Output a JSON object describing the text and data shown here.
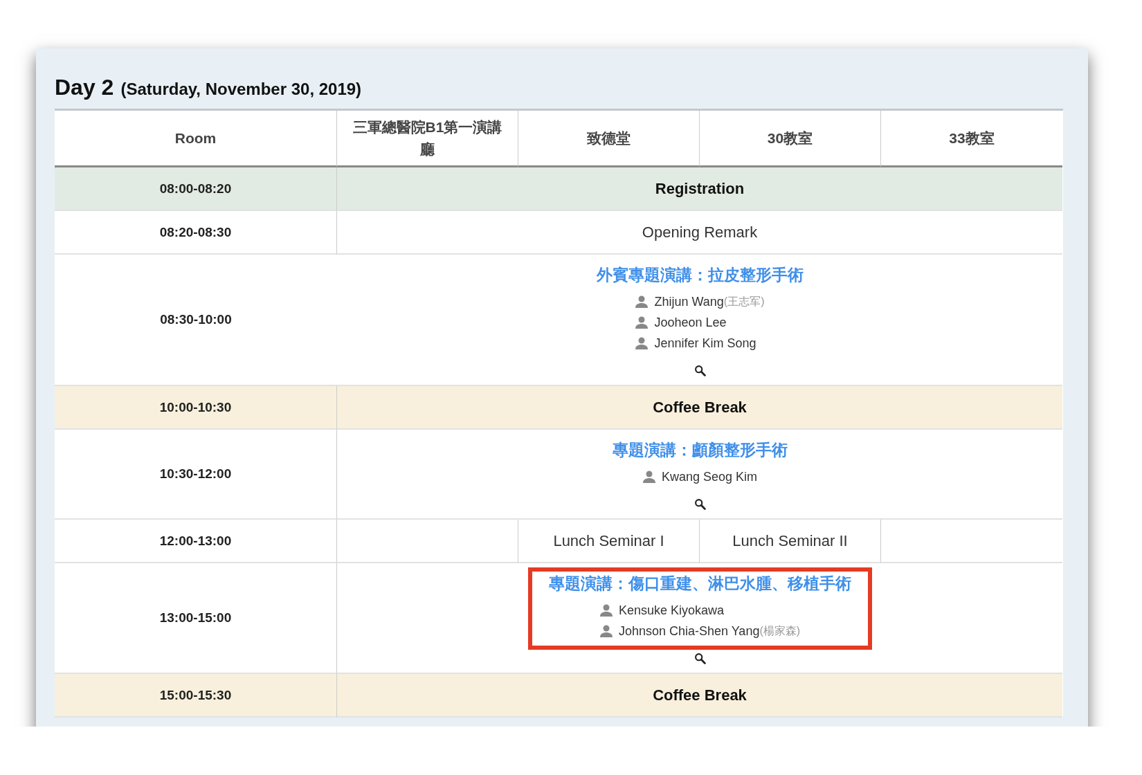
{
  "heading": {
    "title": "Day 2",
    "date": "(Saturday, November 30, 2019)"
  },
  "columns": [
    "Room",
    "三軍總醫院B1第一演講廳",
    "致德堂",
    "30教室",
    "33教室"
  ],
  "rows": [
    {
      "time": "08:00-08:20",
      "kind": "break",
      "label": "Registration",
      "color": "#e2ebe3"
    },
    {
      "time": "08:20-08:30",
      "kind": "plain",
      "label": "Opening Remark"
    },
    {
      "time": "08:30-10:00",
      "kind": "session",
      "title": "外賓專題演講：拉皮整形手術",
      "highlighted": false,
      "speakers": [
        {
          "name": "Zhijun Wang",
          "native": "(王志军)"
        },
        {
          "name": "Jooheon Lee"
        },
        {
          "name": "Jennifer Kim Song"
        }
      ]
    },
    {
      "time": "10:00-10:30",
      "kind": "break",
      "label": "Coffee Break",
      "color": "#f8f0dc"
    },
    {
      "time": "10:30-12:00",
      "kind": "session",
      "title": "專題演講：顱顏整形手術",
      "highlighted": false,
      "speakers": [
        {
          "name": "Kwang Seog Kim"
        }
      ]
    },
    {
      "time": "12:00-13:00",
      "kind": "split",
      "cells": [
        {},
        {
          "text": "Lunch Seminar I"
        },
        {
          "text": "Lunch Seminar II"
        },
        {}
      ]
    },
    {
      "time": "13:00-15:00",
      "kind": "session",
      "title": "專題演講：傷口重建、淋巴水腫、移植手術",
      "highlighted": true,
      "speakers": [
        {
          "name": "Kensuke Kiyokawa"
        },
        {
          "name": "Johnson Chia-Shen Yang",
          "native": "(楊家森)"
        }
      ]
    },
    {
      "time": "15:00-15:30",
      "kind": "break",
      "label": "Coffee Break",
      "color": "#f8f0dc"
    }
  ]
}
